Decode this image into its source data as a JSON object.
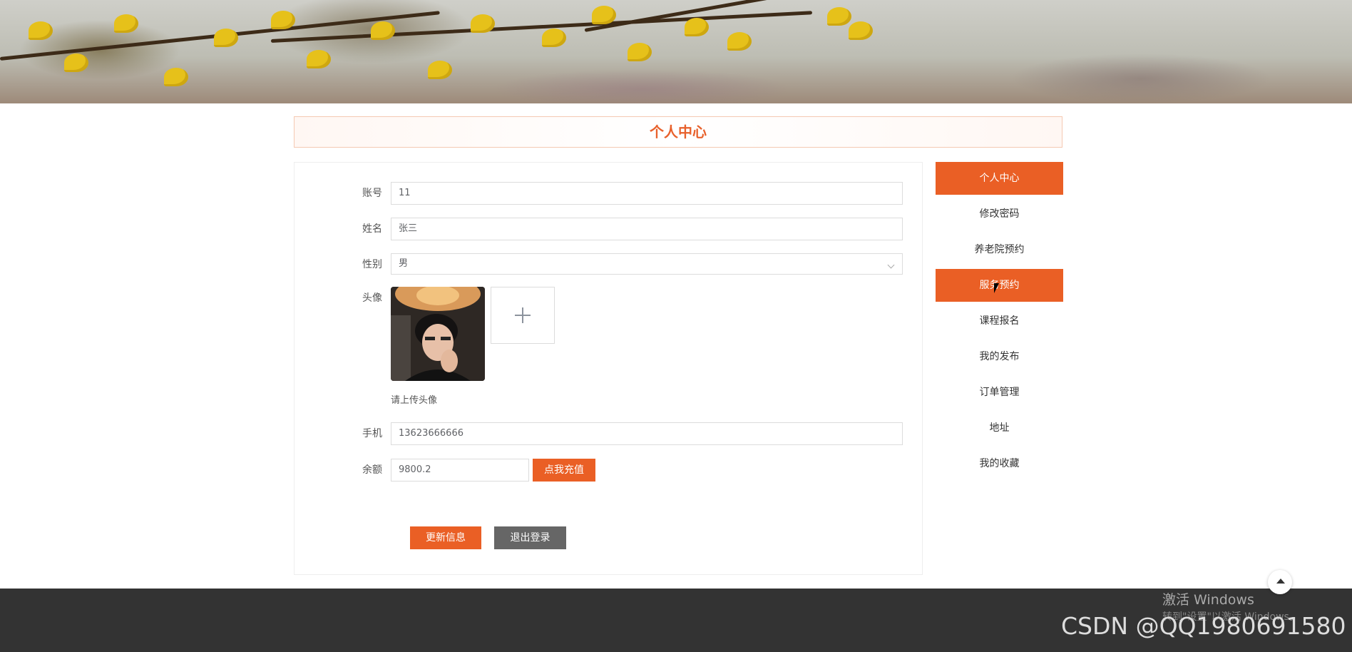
{
  "page": {
    "title": "个人中心"
  },
  "form": {
    "account_label": "账号",
    "account_value": "11",
    "name_label": "姓名",
    "name_value": "张三",
    "gender_label": "性别",
    "gender_value": "男",
    "avatar_label": "头像",
    "avatar_hint": "请上传头像",
    "phone_label": "手机",
    "phone_value": "13623666666",
    "balance_label": "余额",
    "balance_value": "9800.2",
    "recharge_button": "点我充值",
    "update_button": "更新信息",
    "logout_button": "退出登录",
    "upload_plus": "+"
  },
  "sidebar": {
    "items": [
      {
        "label": "个人中心",
        "active": true
      },
      {
        "label": "修改密码",
        "active": false
      },
      {
        "label": "养老院预约",
        "active": false
      },
      {
        "label": "服务预约",
        "active": true
      },
      {
        "label": "课程报名",
        "active": false
      },
      {
        "label": "我的发布",
        "active": false
      },
      {
        "label": "订单管理",
        "active": false
      },
      {
        "label": "地址",
        "active": false
      },
      {
        "label": "我的收藏",
        "active": false
      }
    ]
  },
  "overlay": {
    "activate_windows": "激活 Windows",
    "activate_hint": "转到\"设置\"以激活 Windows。",
    "watermark": "CSDN @QQ1980691580"
  },
  "colors": {
    "accent": "#ea5f25",
    "footer": "#333333",
    "logout": "#666666"
  }
}
